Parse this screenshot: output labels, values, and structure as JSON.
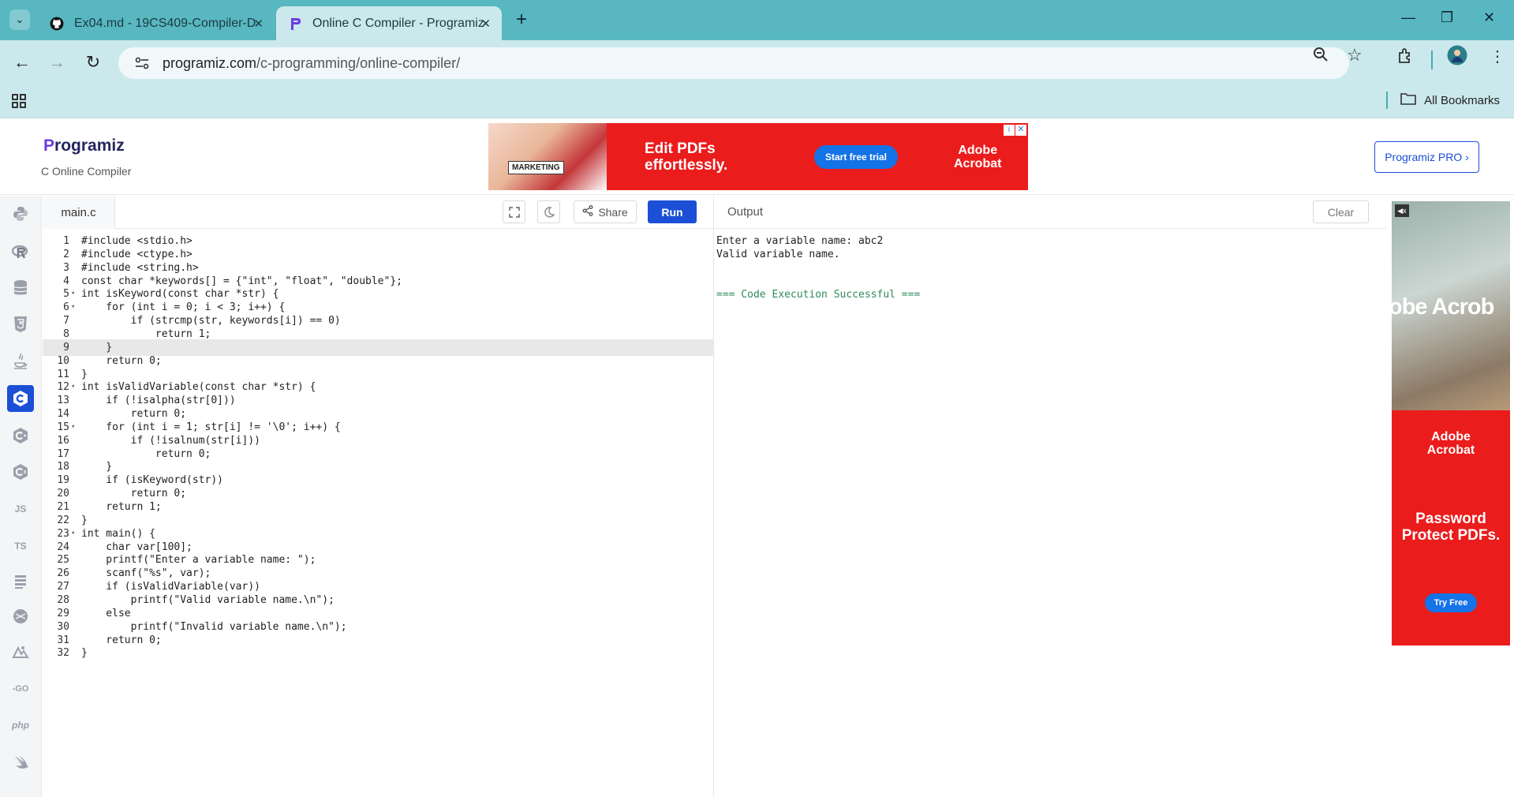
{
  "browser": {
    "tabs": [
      {
        "title": "Ex04.md - 19CS409-Compiler-D",
        "favicon": "github-icon",
        "active": false
      },
      {
        "title": "Online C Compiler - Programiz",
        "favicon": "programiz-icon",
        "active": true
      }
    ],
    "url_host": "programiz.com",
    "url_path": "/c-programming/online-compiler/",
    "bookmarks_label": "All Bookmarks"
  },
  "header": {
    "logo_text": "Programiz",
    "subtitle": "C Online Compiler",
    "pro_button": "Programiz PRO ›"
  },
  "ad_banner": {
    "badge": "MARKETING",
    "headline_line1": "Edit PDFs",
    "headline_line2": "effortlessly.",
    "cta": "Start free trial",
    "brand_line1": "Adobe",
    "brand_line2": "Acrobat"
  },
  "side_ad": {
    "photo_text": "obe Acrob",
    "brand_line1": "Adobe",
    "brand_line2": "Acrobat",
    "copy_line1": "Password",
    "copy_line2": "Protect PDFs.",
    "cta": "Try Free"
  },
  "rail": {
    "items": [
      "python-icon",
      "r-icon",
      "sql-icon",
      "html-icon",
      "java-icon",
      "c-icon",
      "cpp-icon",
      "csharp-icon",
      "js-icon",
      "ts-icon",
      "kotlin-icon",
      "rust-icon",
      "swift-icon",
      "go-icon",
      "php-icon",
      "swift-bird-icon"
    ],
    "js_label": "JS",
    "ts_label": "TS",
    "go_label": "-GO",
    "php_label": "php"
  },
  "editor": {
    "file_name": "main.c",
    "share_label": "Share",
    "run_label": "Run",
    "highlighted_line": 9,
    "lines": [
      "#include <stdio.h>",
      "#include <ctype.h>",
      "#include <string.h>",
      "const char *keywords[] = {\"int\", \"float\", \"double\"};",
      "int isKeyword(const char *str) {",
      "    for (int i = 0; i < 3; i++) {",
      "        if (strcmp(str, keywords[i]) == 0)",
      "            return 1;",
      "    }",
      "    return 0;",
      "}",
      "int isValidVariable(const char *str) {",
      "    if (!isalpha(str[0]))",
      "        return 0;",
      "    for (int i = 1; str[i] != '\\0'; i++) {",
      "        if (!isalnum(str[i]))",
      "            return 0;",
      "    }",
      "    if (isKeyword(str))",
      "        return 0;",
      "    return 1;",
      "}",
      "int main() {",
      "    char var[100];",
      "    printf(\"Enter a variable name: \");",
      "    scanf(\"%s\", var);",
      "    if (isValidVariable(var))",
      "        printf(\"Valid variable name.\\n\");",
      "    else",
      "        printf(\"Invalid variable name.\\n\");",
      "    return 0;",
      "}"
    ],
    "fold_lines": [
      5,
      6,
      12,
      15,
      23
    ]
  },
  "output": {
    "title": "Output",
    "clear_label": "Clear",
    "lines": [
      {
        "text": "Enter a variable name: abc2",
        "status": "normal"
      },
      {
        "text": "Valid variable name.",
        "status": "normal"
      },
      {
        "text": "",
        "status": "normal"
      },
      {
        "text": "",
        "status": "normal"
      },
      {
        "text": "=== Code Execution Successful ===",
        "status": "success"
      }
    ]
  },
  "colors": {
    "accent": "#1b4fd6",
    "tab_bar": "#58b7c1",
    "toolbar": "#cbe9ec",
    "ad_red": "#eb1c1c",
    "success": "#2f8a5a"
  }
}
